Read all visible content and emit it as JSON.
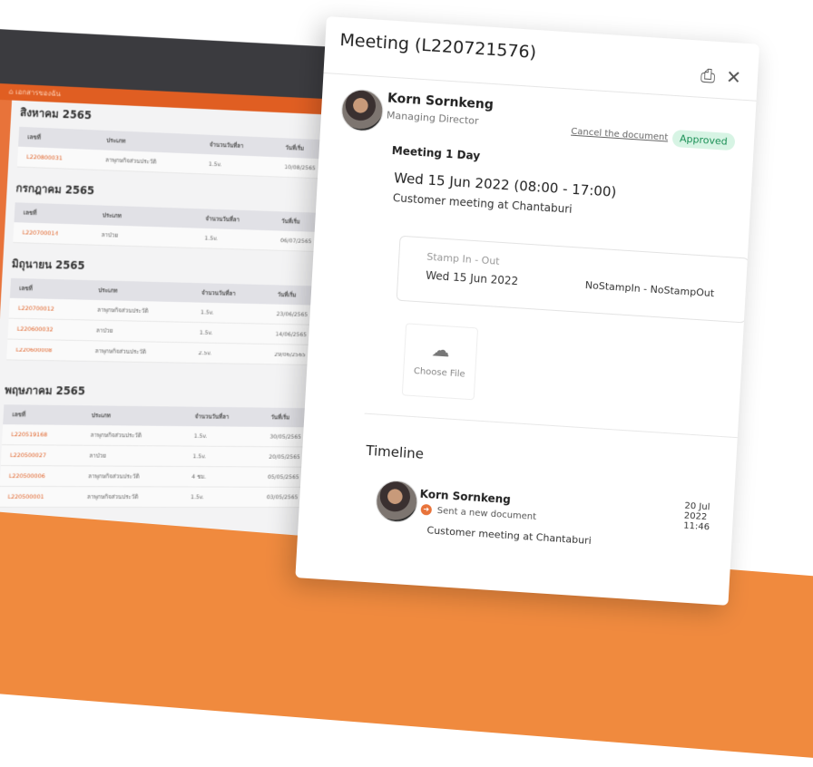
{
  "background_app": {
    "breadcrumb": "เอกสารของฉัน",
    "columns": [
      "เลขที่",
      "ประเภท",
      "จำนวนวันที่ลา",
      "วันที่เริ่ม"
    ],
    "sections": [
      {
        "title": "สิงหาคม 2565",
        "rows": [
          [
            "L220800031",
            "ลาพุกษกิจส่วนประวัติ",
            "1.5v.",
            "10/08/2565"
          ]
        ]
      },
      {
        "title": "กรกฎาคม 2565",
        "rows": [
          [
            "L220700014",
            "ลาป่วย",
            "1.5v.",
            "06/07/2565"
          ]
        ]
      },
      {
        "title": "มิถุนายน 2565",
        "rows": [
          [
            "L220700012",
            "ลาพุกษกิจส่วนประวัติ",
            "1.5v.",
            "23/06/2565"
          ],
          [
            "L220600032",
            "ลาป่วย",
            "1.5v.",
            "14/06/2565"
          ],
          [
            "L220600008",
            "ลาพุกษกิจส่วนประวัติ",
            "2.5v.",
            "29/06/2565"
          ]
        ]
      },
      {
        "title": "พฤษภาคม 2565",
        "rows": [
          [
            "L220519168",
            "ลาพุกษกิจส่วนประวัติ",
            "1.5v.",
            "30/05/2565"
          ],
          [
            "L220500027",
            "ลาป่วย",
            "1.5v.",
            "20/05/2565"
          ],
          [
            "L220500006",
            "ลาพุกษกิจส่วนประวัติ",
            "4 ชม.",
            "05/05/2565"
          ],
          [
            "L220500001",
            "ลาพุกษกิจส่วนประวัติ",
            "1.5v.",
            "03/05/2565"
          ]
        ]
      }
    ]
  },
  "modal": {
    "title": "Meeting (L220721576)",
    "print_icon": "printer-icon",
    "close_icon": "close-icon",
    "requester": {
      "name": "Korn Sornkeng",
      "role": "Managing Director"
    },
    "cancel_label": "Cancel the document",
    "status": "Approved",
    "type": "Meeting 1 Day",
    "date_range": "Wed 15 Jun 2022 (08:00 - 17:00)",
    "description": "Customer meeting at Chantaburi",
    "stamp": {
      "label": "Stamp In - Out",
      "date": "Wed 15 Jun 2022",
      "status": "NoStampIn - NoStampOut"
    },
    "upload_label": "Choose File",
    "timeline": {
      "title": "Timeline",
      "entries": [
        {
          "name": "Korn Sornkeng",
          "time": "20 Jul 2022 11:46",
          "action": "Sent a new document",
          "description": "Customer meeting at Chantaburi"
        }
      ]
    }
  },
  "colors": {
    "accent": "#e8733a",
    "approved": "#1a8f55"
  }
}
